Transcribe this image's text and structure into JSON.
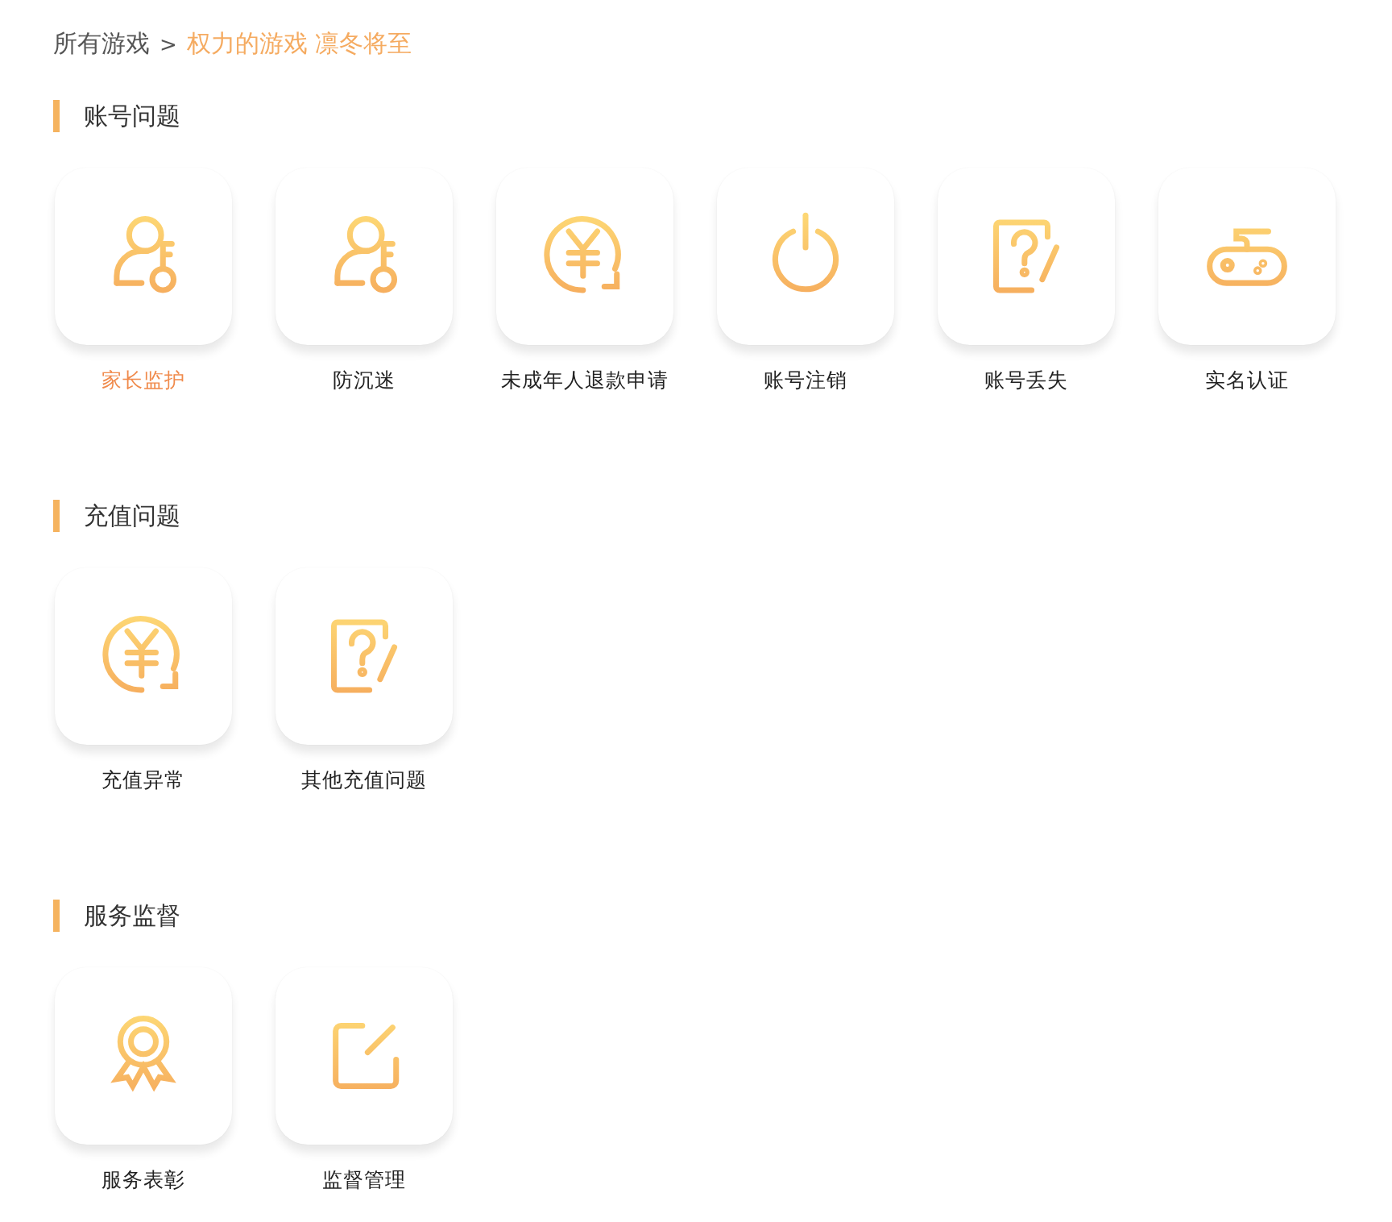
{
  "breadcrumb": {
    "root": "所有游戏",
    "separator": ">",
    "current": "权力的游戏 凛冬将至"
  },
  "sections": [
    {
      "title": "账号问题",
      "items": [
        {
          "label": "家长监护",
          "kind": "person-key",
          "selected": true
        },
        {
          "label": "防沉迷",
          "kind": "person-key",
          "selected": false
        },
        {
          "label": "未成年人退款申请",
          "kind": "yen-refresh",
          "selected": false
        },
        {
          "label": "账号注销",
          "kind": "power",
          "selected": false
        },
        {
          "label": "账号丢失",
          "kind": "question-note",
          "selected": false
        },
        {
          "label": "实名认证",
          "kind": "gamepad",
          "selected": false
        }
      ]
    },
    {
      "title": "充值问题",
      "items": [
        {
          "label": "充值异常",
          "kind": "yen-refresh",
          "selected": false
        },
        {
          "label": "其他充值问题",
          "kind": "question-note",
          "selected": false
        }
      ]
    },
    {
      "title": "服务监督",
      "items": [
        {
          "label": "服务表彰",
          "kind": "award",
          "selected": false
        },
        {
          "label": "监督管理",
          "kind": "edit",
          "selected": false
        }
      ]
    }
  ]
}
